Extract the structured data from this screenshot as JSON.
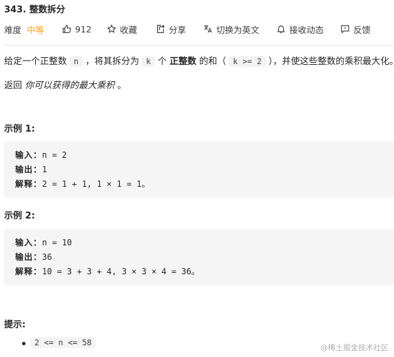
{
  "problem": {
    "title": "343. 整数拆分"
  },
  "meta": {
    "difficulty_label": "难度",
    "difficulty_value": "中等",
    "likes": "912",
    "favorite": "收藏",
    "share": "分享",
    "translate": "切换为英文",
    "subscribe": "接收动态",
    "feedback": "反馈"
  },
  "description": {
    "p1_a": "给定一个正整数",
    "p1_n": "n",
    "p1_b": "，将其拆分为",
    "p1_k": "k",
    "p1_c": "个",
    "p1_strong": "正整数",
    "p1_d": "的和（",
    "p1_cond": "k >= 2",
    "p1_e": "），并使这些整数的乘积最大化。",
    "p2_a": "返回",
    "p2_em": "你可以获得的最大乘积",
    "p2_b": "。"
  },
  "examples": [
    {
      "heading": "示例 1:",
      "input_label": "输入：",
      "input_value": "n = 2",
      "output_label": "输出：",
      "output_value": "1",
      "explain_label": "解释：",
      "explain_value": "2 = 1 + 1, 1 × 1 = 1。"
    },
    {
      "heading": "示例 2:",
      "input_label": "输入：",
      "input_value": "n = 10",
      "output_label": "输出：",
      "output_value": "36",
      "explain_label": "解释：",
      "explain_value": "10 = 3 + 3 + 4, 3 × 3 × 4 = 36。"
    }
  ],
  "hints": {
    "heading": "提示:",
    "items": [
      "2 <= n <= 58"
    ]
  },
  "watermark": "@稀土掘金技术社区"
}
